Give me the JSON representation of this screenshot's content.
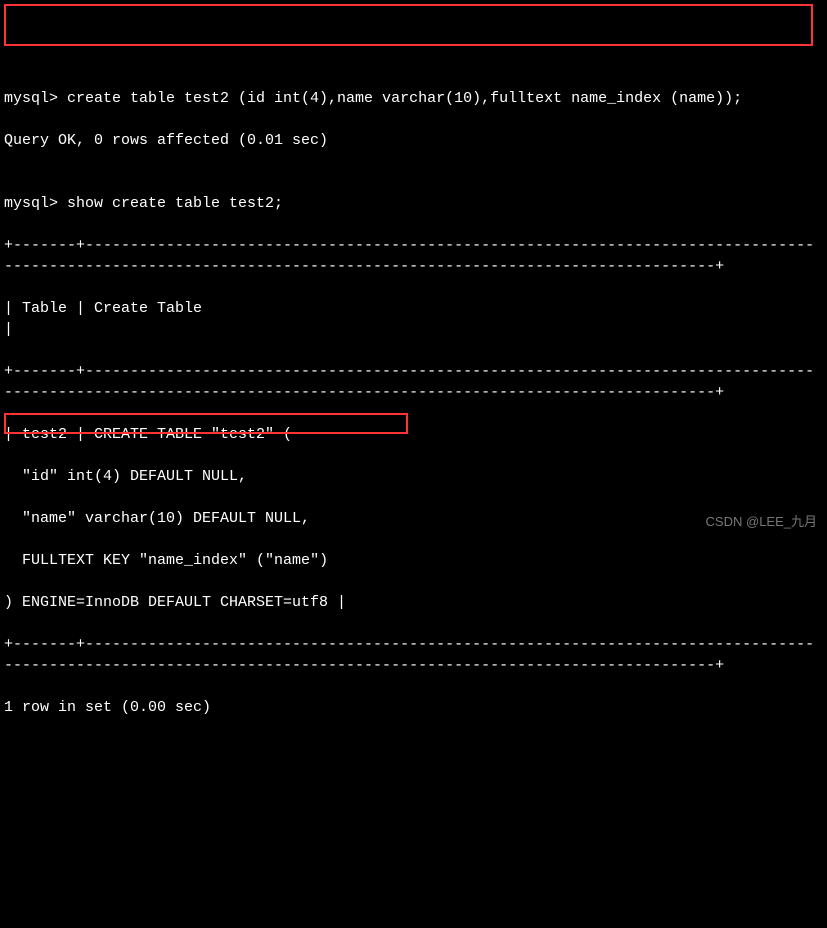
{
  "terminal": {
    "lines": [
      "mysql> create table test2 (id int(4),name varchar(10),fulltext name_index (name));",
      "Query OK, 0 rows affected (0.01 sec)",
      "",
      "mysql> show create table test2;",
      "+-------+----------------------------------------------------------------------------------------------------------------------------------------------------------------+",
      "| Table | Create Table                                                                                                                                                   |",
      "+-------+----------------------------------------------------------------------------------------------------------------------------------------------------------------+",
      "| test2 | CREATE TABLE \"test2\" (",
      "  \"id\" int(4) DEFAULT NULL,",
      "  \"name\" varchar(10) DEFAULT NULL,",
      "  FULLTEXT KEY \"name_index\" (\"name\")",
      ") ENGINE=InnoDB DEFAULT CHARSET=utf8 |",
      "+-------+----------------------------------------------------------------------------------------------------------------------------------------------------------------+",
      "1 row in set (0.00 sec)"
    ]
  },
  "watermark": "CSDN @LEE_九月"
}
